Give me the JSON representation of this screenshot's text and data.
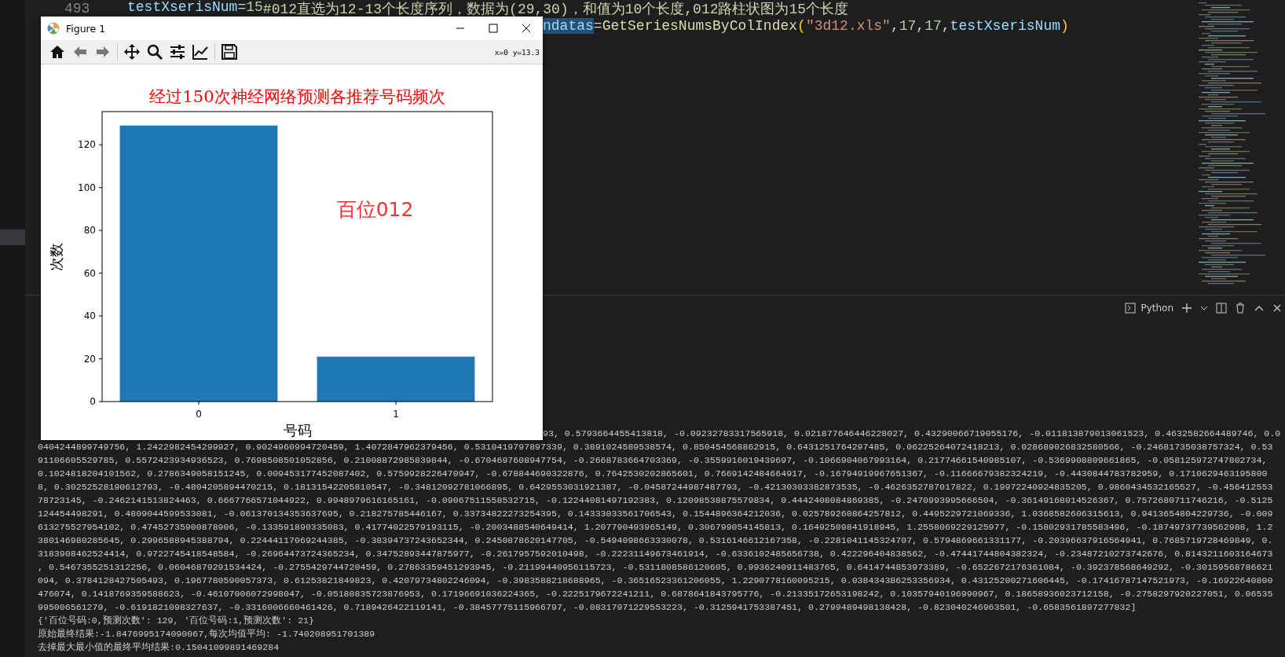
{
  "editor": {
    "lines": [
      {
        "number": "493",
        "tokens": [
          {
            "text": "testXserisNum",
            "kind": "variable",
            "highlighted": false
          },
          {
            "text": "=",
            "kind": "operator",
            "highlighted": false
          },
          {
            "text": "15",
            "kind": "number",
            "highlighted": false
          },
          {
            "text": "#012直选为12-13个长度序列，数据为(29,30)，和值为10个长度,012路柱状图为15个长度",
            "kind": "comment",
            "highlighted": false
          }
        ]
      },
      {
        "tokens": [
          {
            "text": "ndatas",
            "kind": "variable",
            "highlighted": true
          },
          {
            "text": "=",
            "kind": "operator",
            "highlighted": false
          },
          {
            "text": "GetSeriesNumsByColIndex",
            "kind": "function",
            "highlighted": false
          },
          {
            "text": "(",
            "kind": "bracket",
            "highlighted": false
          },
          {
            "text": "\"3d12.xls\"",
            "kind": "string",
            "highlighted": false
          },
          {
            "text": ",",
            "kind": "operator",
            "highlighted": false
          },
          {
            "text": "17",
            "kind": "number",
            "highlighted": false
          },
          {
            "text": ",",
            "kind": "operator",
            "highlighted": false
          },
          {
            "text": "17",
            "kind": "number",
            "highlighted": false
          },
          {
            "text": ",",
            "kind": "operator",
            "highlighted": false
          },
          {
            "text": "testXserisNum",
            "kind": "variable",
            "highlighted": false
          },
          {
            "text": ")",
            "kind": "bracket",
            "highlighted": false
          }
        ]
      }
    ]
  },
  "figure_window": {
    "title": "Figure 1",
    "toolbar": {
      "coordinates": "x=0 y=13.3"
    },
    "chart_data": {
      "type": "bar",
      "title": "经过150次神经网络预测各推荐号码频次",
      "xlabel": "号码",
      "ylabel": "次数",
      "categories": [
        "0",
        "1"
      ],
      "values": [
        129,
        21
      ],
      "ylim": [
        0,
        135.5
      ],
      "yticks": [
        0,
        20,
        40,
        60,
        80,
        100,
        120
      ],
      "annotations": [
        "百位012"
      ]
    }
  },
  "panel": {
    "profile": "Python"
  },
  "terminal": {
    "lines": [
      "93, 0.5793664455413818, -0.09232783317565918, 0.021877646446228027, 0.43290066719055176, -0.011813879013061523, 0.4632582664489746, 0.0",
      "0404244899749756, 1.2422982454299927, 0.9024960994720459, 1.4072847962379456, 0.5310419797897339, 0.3891024589538574, 0.850454568862915, 0.6431251764297485, 0.06225264072418213, 0.028689026832580566, -0.24681735038757324, 0.53",
      "91106605529785, 0.5572423934936523, 0.7698508501052856, 0.21008872985839844, -0.6704697608947754, -0.2668783664703369, -0.3559916019439697, -0.1066904067993164, 0.21774661540985107, -0.5369908809661865, -0.058125972747802734,",
      "0.1024818204101562, 0.2786349058151245, 0.009453177452087402, 0.5759928226470947, -0.678844690322876, 0.7642530202865601, 0.7669142484664917, -0.16794919967651367, -0.11666679382324219, -0.4430844783782959, 0.1710629463195800",
      "8, 0.30252528190612793, -0.4804205894470215, 0.18131542205810547, -0.34812092781066895, 0.6429553031921387, -0.04587244987487793, -0.42130303382873535, -0.4626352787017822, 0.19972240924835205, 0.9860434532165527, -0.456412553",
      "78723145, -0.2462141513824463, 0.6667766571044922, 0.9948979616165161, -0.09067511558532715, -0.12244081497192383, 0.12098538875579834, 0.4442408084869385, -0.2470993995666504, -0.36149168014526367, 0.7572680711746216, -0.5125",
      "124454498291, 0.4809044599533081, -0.061370134353637695, 0.218275785446167, 0.33734822273254395, 0.14333033561706543, 0.1544896364212036, 0.025789260864257812, 0.4495229721069336, 1.0368582606315613, 0.9413654804229736, -0.009",
      "613275527954102, 0.47452735900878906, -0.133591890335083, 0.41774022579193115, -0.2003488540649414, 1.207790493965149, 0.306799054145813, 0.16492509841918945, 1.2558069229125977, -0.15802931785583496, -0.18749737739562988, 1.2",
      "380146980285645, 0.2996588945388794, 0.22444117069244385, -0.38394737243652344, 0.2450878620147705, -0.5494098663330078, 0.5316146612167358, -0.2281041145324707, 0.5794869661331177, -0.20396637916564941, 0.7685719728469849, 0.",
      "3183908462524414, 0.9722745418548584, -0.26964473724365234, 0.34752893447875977, -0.2617957592010498, -0.22231149673461914, -0.6336102485656738, 0.422296404838562, -0.47441744804382324, -0.23487210273742676, 0.8143211603164673",
      ", 0.5467355251312256, 0.06046879291534424, -0.2755429744720459, 0.27863359451293945, -0.21199440956115723, -0.5311808586120605, 0.9936240911483765, 0.6414744853973389, -0.6522672176361084, -0.392378568649292, -0.30159568786621",
      "094, 0.3784128427505493, 0.1967780590057373, 0.61253821849823, 0.42079734802246094, -0.3983588218688965, -0.36516523361206055, 1.2290778160095215, 0.038434386253356934, 0.43125200271606445, -0.17416787147521973, -0.16922640800",
      "476074, 0.1418769359588623, -0.46107006072998047, -0.05180835723876953, 0.17196691036224365, -0.2225179672241211, 0.6878641843795776, -0.21335172653198242, 0.10357940196990967, 0.18658936023712158, -0.2758297920227051, 0.06535",
      "995006561279, -0.6191821098327637, -0.3316006660461426, 0.7189426422119141, -0.38457775115966797, -0.08317971229553223, -0.3125941753387451, 0.2799489498138428, -0.823040246963501, -0.6583561897277832]",
      "{'百位号码:0,预测次数': 129, '百位号码:1,预测次数': 21}",
      "原始最终结果:-1.8476995174090067,每次均值平均: -1.740208951701389",
      "去掉最大最小值的最终平均结果:0.15041099891469284"
    ]
  }
}
